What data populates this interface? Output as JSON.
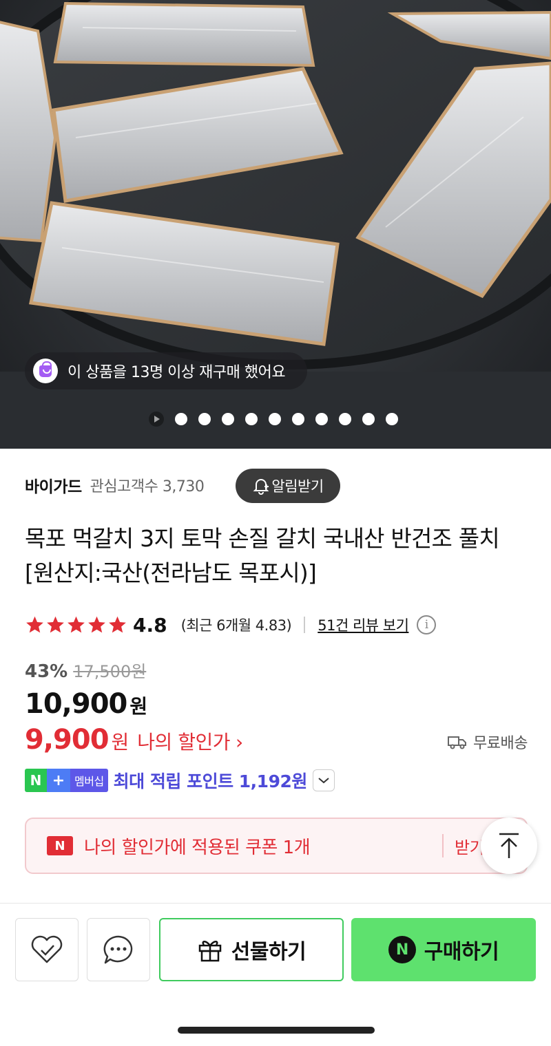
{
  "hero": {
    "repurchase_text": "이 상품을 13명 이상 재구매 했어요",
    "dot_count": 10
  },
  "seller": {
    "name": "바이가드",
    "fans_label": "관심고객수 3,730",
    "alert_label": "알림받기"
  },
  "product": {
    "title": "목포 먹갈치 3지 토막 손질 갈치 국내산 반건조 풀치 [원산지:국산(전라남도 목포시)]"
  },
  "rating": {
    "stars": 5,
    "score": "4.8",
    "recent": "(최근 6개월 4.83)",
    "reviews_link": "51건 리뷰 보기",
    "star_color": "#e12d35"
  },
  "price": {
    "discount_pct": "43%",
    "original": "17,500원",
    "sale_number": "10,900",
    "sale_unit": "원",
    "my_number": "9,900",
    "my_unit": "원",
    "my_label": "나의 할인가",
    "my_chevron": "›",
    "shipping": "무료배송"
  },
  "membership": {
    "badge_n": "N",
    "badge_plus": "+",
    "badge_text": "멤버십",
    "points_text": "최대 적립 포인트 1,192원"
  },
  "coupon": {
    "logo": "N",
    "text": "나의 할인가에 적용된 쿠폰 1개",
    "get_label": "받기"
  },
  "bottom": {
    "gift_label": "선물하기",
    "buy_logo": "N",
    "buy_label": "구매하기",
    "buy_color": "#5ee16e"
  }
}
